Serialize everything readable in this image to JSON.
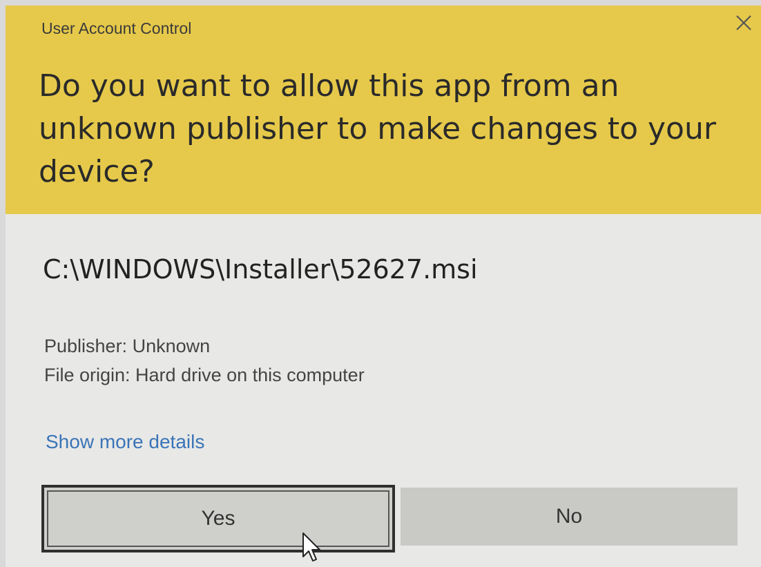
{
  "window": {
    "title": "User Account Control",
    "close_icon": "close-icon"
  },
  "prompt": {
    "question": "Do you want to allow this app from an unknown publisher to make changes to your device?"
  },
  "app": {
    "path": "C:\\WINDOWS\\Installer\\52627.msi",
    "publisher": "Publisher: Unknown",
    "file_origin": "File origin: Hard drive on this computer"
  },
  "links": {
    "show_more": "Show more details"
  },
  "buttons": {
    "yes": "Yes",
    "no": "No"
  },
  "colors": {
    "header": "#e6c94a",
    "body": "#e8e8e6",
    "link": "#3a74b8"
  }
}
